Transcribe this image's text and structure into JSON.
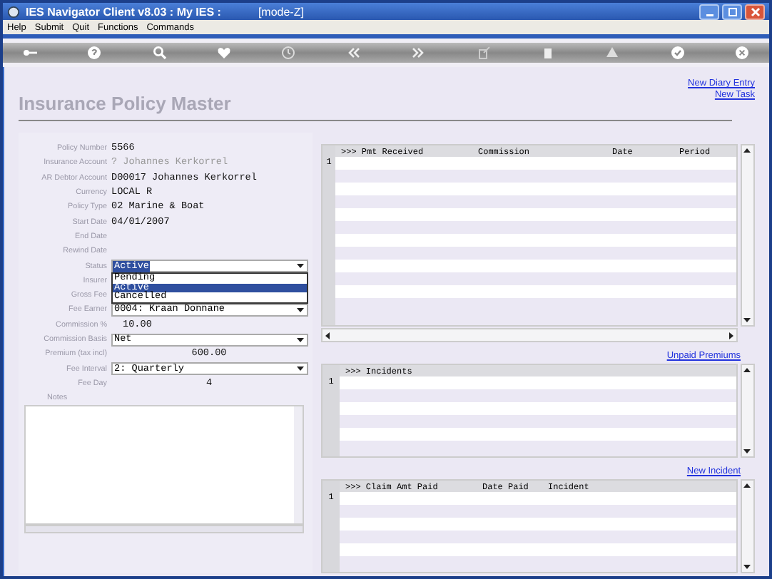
{
  "window": {
    "title": "IES Navigator Client v8.03 : My IES :",
    "mode": "[mode-Z]"
  },
  "menu": [
    "Help",
    "Submit",
    "Quit",
    "Functions",
    "Commands"
  ],
  "page": {
    "title": "Insurance Policy Master",
    "links": [
      "New Diary Entry",
      "New Task"
    ]
  },
  "form": {
    "fields": [
      {
        "label": "Policy Number",
        "value": "5566",
        "kind": "text"
      },
      {
        "label": "Insurance Account",
        "value": "? Johannes Kerkorrel",
        "kind": "readonly"
      },
      {
        "label": "AR Debtor Account",
        "value": "D00017 Johannes Kerkorrel",
        "kind": "text"
      },
      {
        "label": "Currency",
        "value": "LOCAL R",
        "kind": "text"
      },
      {
        "label": "Policy Type",
        "value": "02 Marine & Boat",
        "kind": "text"
      },
      {
        "label": "Start Date",
        "value": "04/01/2007",
        "kind": "text"
      },
      {
        "label": "End Date",
        "kind": "text"
      },
      {
        "label": "Rewind Date",
        "kind": "text"
      },
      {
        "label": "Status",
        "value": "Active",
        "kind": "dropdown",
        "expanded": true,
        "options": [
          {
            "label": "Pending",
            "selected": false
          },
          {
            "label": "Active",
            "selected": true
          },
          {
            "label": "Cancelled",
            "selected": false
          }
        ]
      },
      {
        "label": "Insurer",
        "kind": "text"
      },
      {
        "label": "Gross Fee",
        "kind": "text"
      },
      {
        "label": "Fee Earner",
        "value": "0004: Kraan Donnane",
        "kind": "dropdown",
        "expanded": false
      },
      {
        "label": "Commission %",
        "value": "10.00",
        "kind": "number"
      },
      {
        "label": "Commission Basis",
        "value": "Net",
        "kind": "dropdown",
        "expanded": false
      },
      {
        "label": "Premium (tax incl)",
        "value": "600.00",
        "kind": "amount"
      },
      {
        "label": "Fee Interval",
        "value": "2: Quarterly",
        "kind": "dropdown",
        "expanded": false
      },
      {
        "label": "Fee Day",
        "value": "4",
        "kind": "amount"
      }
    ],
    "notes_label": "Notes"
  },
  "right": [
    {
      "kind": "grid",
      "columns": [
        ">>> Pmt Received",
        "Commission",
        "Date",
        "Period"
      ],
      "row_numbers": [
        "1"
      ]
    },
    {
      "kind": "link",
      "text": "Unpaid Premiums"
    },
    {
      "kind": "grid",
      "columns": [
        ">>> Incidents"
      ],
      "row_numbers": [
        "1"
      ]
    },
    {
      "kind": "link",
      "text": "New Incident"
    },
    {
      "kind": "grid",
      "columns": [
        ">>> Claim Amt Paid",
        "Date Paid",
        "Incident"
      ],
      "row_numbers": [
        "1"
      ]
    }
  ]
}
